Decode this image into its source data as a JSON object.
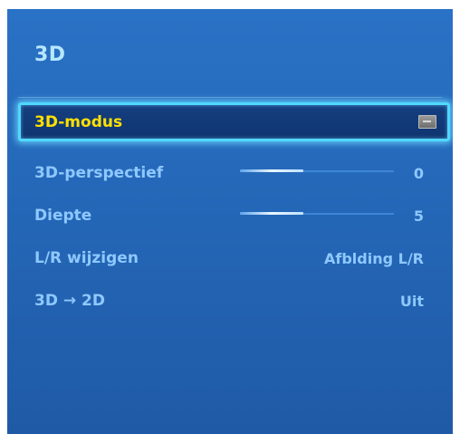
{
  "title": "3D",
  "menu": {
    "selected": {
      "label": "3D-modus",
      "icon": "enter-icon"
    },
    "items": [
      {
        "label": "3D-perspectief",
        "value": "0",
        "slider_level": 0.41
      },
      {
        "label": "Diepte",
        "value": "5",
        "slider_level": 0.41
      },
      {
        "label": "L/R wijzigen",
        "value": "Afblding L/R"
      },
      {
        "label": "3D → 2D",
        "value": "Uit"
      }
    ]
  },
  "colors": {
    "panel": "#2466b6",
    "title": "#b6e7ff",
    "item_text": "#8ec8ff",
    "selected_text": "#ffe000",
    "focus_border": "#4fd8ff"
  }
}
